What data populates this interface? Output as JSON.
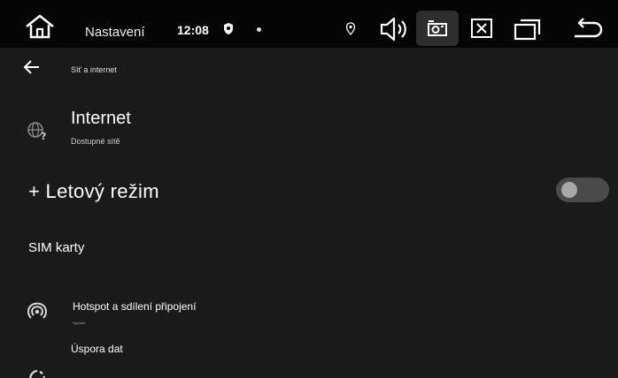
{
  "statusbar": {
    "title": "Nastavení",
    "clock": "12:08"
  },
  "header": {
    "breadcrumb": "Síť a internet"
  },
  "settings": {
    "internet": {
      "title": "Internet",
      "subtitle": "Dostupné sítě"
    },
    "airplane": {
      "title": "+ Letový režim",
      "enabled": false
    },
    "sim": {
      "title": "SIM karty"
    },
    "hotspot": {
      "title": "Hotspot a sdílení připojení",
      "subtitle": "Vypnuto"
    },
    "datasaver": {
      "title": "Úspora dat"
    }
  },
  "icons": {
    "home": "home-icon",
    "shield": "shield-icon",
    "location": "location-icon",
    "volume": "volume-icon",
    "screenshot": "camera-icon",
    "close": "close-icon",
    "recents": "recents-icon",
    "back": "back-icon",
    "arrow_back": "arrow-back-icon",
    "internet": "globe-question-icon",
    "hotspot": "hotspot-icon",
    "datasaver": "data-saver-icon"
  },
  "colors": {
    "background": "#1a1a1a",
    "topbar": "#050505",
    "highlight": "#2e2e2e",
    "toggle_track": "#4a4a4a",
    "toggle_knob": "#a8a8a8"
  }
}
